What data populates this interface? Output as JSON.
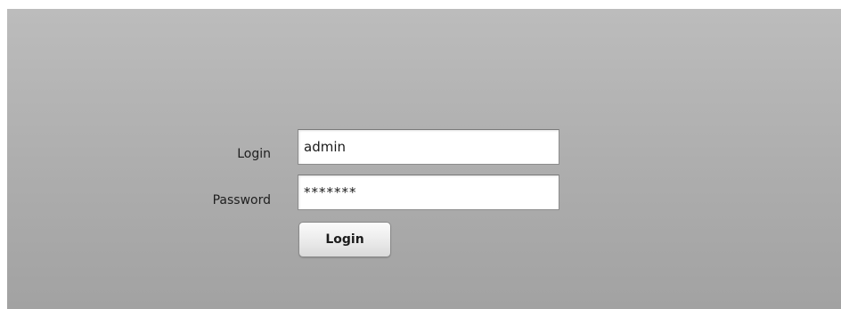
{
  "form": {
    "login_label": "Login",
    "login_value": "admin",
    "password_label": "Password",
    "password_value": "*******",
    "submit_label": "Login"
  },
  "colors": {
    "panel_top": "#bcbcbc",
    "panel_bottom": "#a2a2a2",
    "input_background": "#ffffff",
    "text": "#1e1e1e"
  }
}
